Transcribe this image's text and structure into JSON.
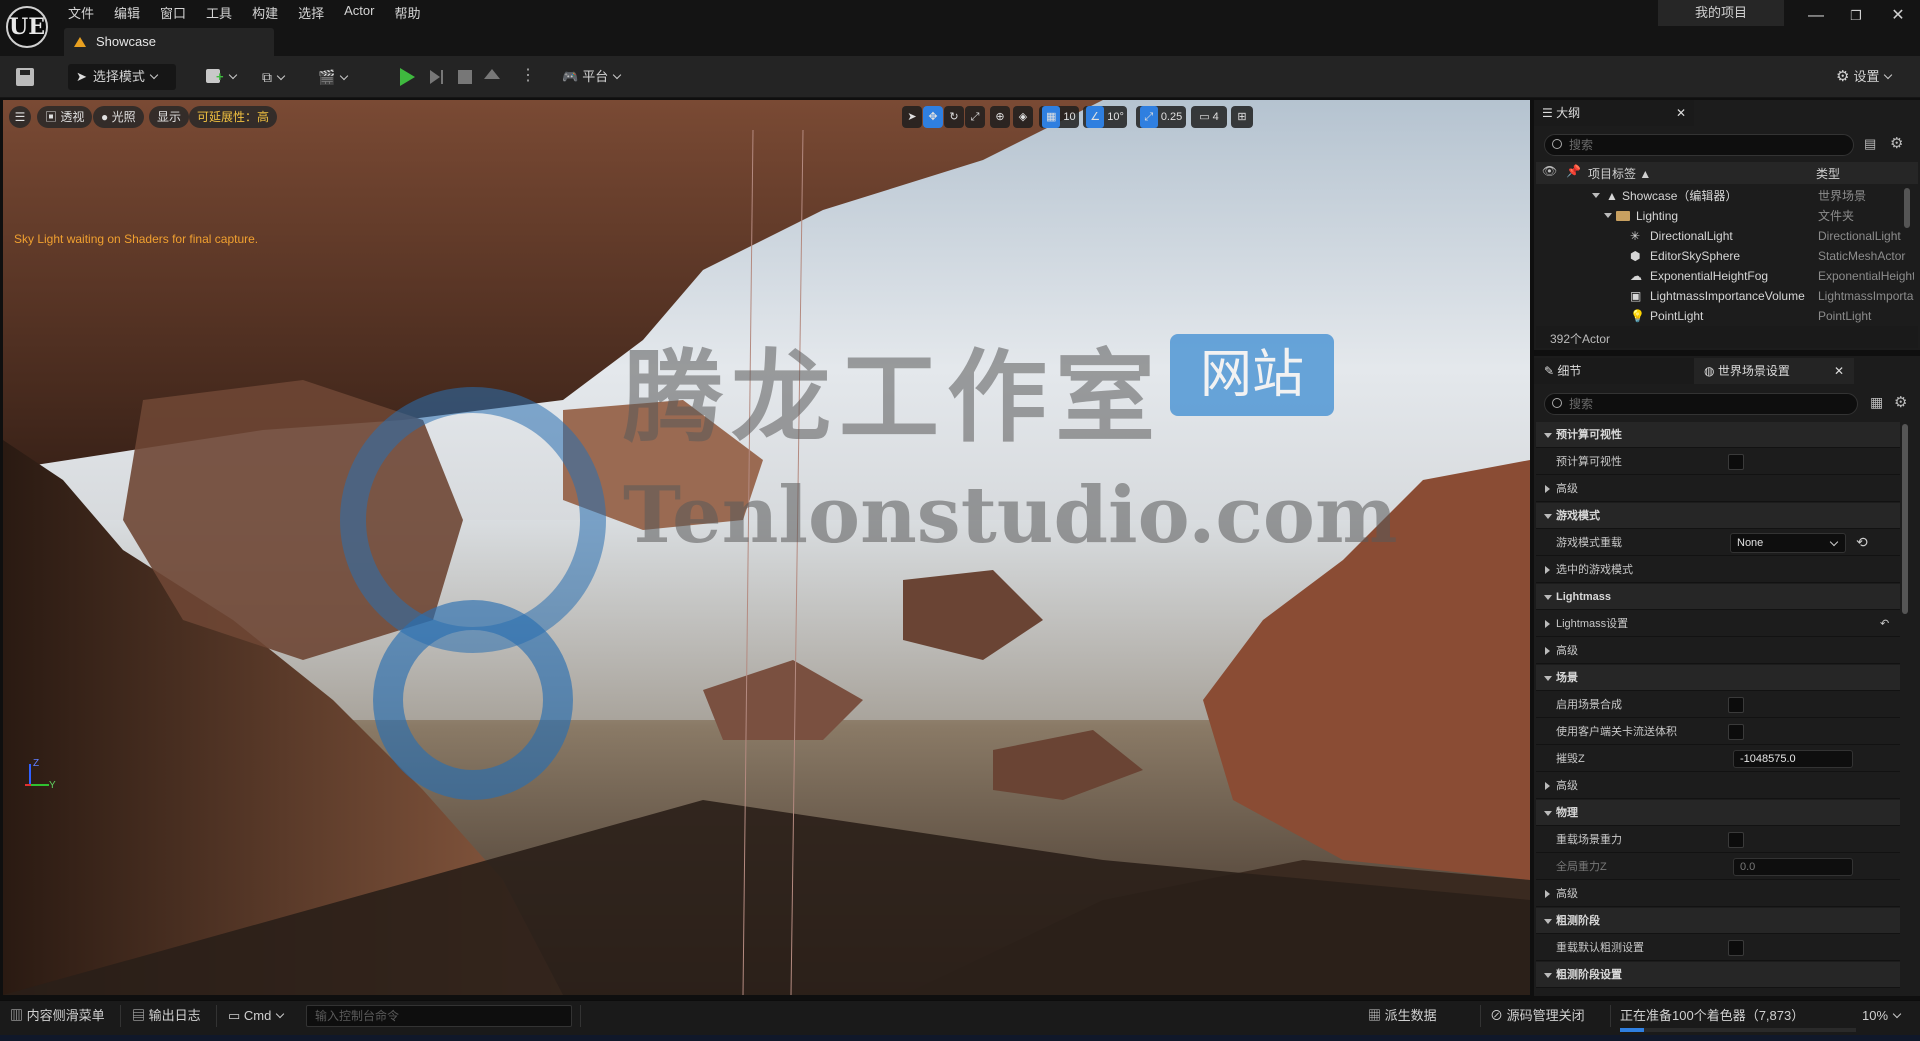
{
  "app": {
    "logo": "UE"
  },
  "menu": [
    "文件",
    "编辑",
    "窗口",
    "工具",
    "构建",
    "选择",
    "Actor",
    "帮助"
  ],
  "document_tab": {
    "label": "Showcase"
  },
  "project_name": "我的项目",
  "window_controls": {
    "minimize": "—",
    "restore": "❐",
    "close": "✕"
  },
  "toolbar": {
    "mode_label": "选择模式",
    "platform_label": "平台",
    "settings_label": "设置"
  },
  "viewport": {
    "chips": [
      "透视",
      "光照",
      "显示"
    ],
    "scalability_label": "可延展性：高",
    "grid_snap": "10",
    "rotation_snap": "10°",
    "scale_snap": "0.25",
    "camera_speed": "4",
    "message": "Sky Light waiting on Shaders for final capture.",
    "watermark_cn": "腾龙工作室",
    "watermark_badge": "网站",
    "watermark_en": "Tenlonstudio.com",
    "axis_label_z": "Z",
    "axis_label_y": "Y"
  },
  "outliner": {
    "title": "大纲",
    "search_placeholder": "搜索",
    "col_label": "项目标签 ▲",
    "col_type": "类型",
    "rows": [
      {
        "label": "Showcase（编辑器）",
        "type": "世界场景"
      },
      {
        "label": "Lighting",
        "type": "文件夹"
      },
      {
        "label": "DirectionalLight",
        "type": "DirectionalLight"
      },
      {
        "label": "EditorSkySphere",
        "type": "StaticMeshActor"
      },
      {
        "label": "ExponentialHeightFog",
        "type": "ExponentialHeightFog"
      },
      {
        "label": "LightmassImportanceVolume",
        "type": "LightmassImportanceVolume"
      },
      {
        "label": "PointLight",
        "type": "PointLight"
      }
    ],
    "count": "392个Actor"
  },
  "details": {
    "tab_details": "细节",
    "tab_world": "世界场景设置",
    "search_placeholder": "搜索",
    "rows": [
      {
        "label": "预计算可视性",
        "kind": "cat"
      },
      {
        "label": "预计算可视性",
        "kind": "prop"
      },
      {
        "label": "高级",
        "kind": "sub"
      },
      {
        "label": "游戏模式",
        "kind": "cat"
      },
      {
        "label": "游戏模式重载",
        "kind": "prop"
      },
      {
        "label": "选中的游戏模式",
        "kind": "sub"
      },
      {
        "label": "Lightmass",
        "kind": "cat"
      },
      {
        "label": "Lightmass设置",
        "kind": "sub"
      },
      {
        "label": "高级",
        "kind": "sub"
      },
      {
        "label": "场景",
        "kind": "cat"
      },
      {
        "label": "启用场景合成",
        "kind": "prop"
      },
      {
        "label": "使用客户端关卡流送体积",
        "kind": "prop"
      },
      {
        "label": "摧毁Z",
        "kind": "prop"
      },
      {
        "label": "高级",
        "kind": "sub"
      },
      {
        "label": "物理",
        "kind": "cat"
      },
      {
        "label": "重载场景重力",
        "kind": "prop"
      },
      {
        "label": "全局重力Z",
        "kind": "prop"
      },
      {
        "label": "高级",
        "kind": "sub"
      },
      {
        "label": "粗测阶段",
        "kind": "cat"
      },
      {
        "label": "重载默认粗测设置",
        "kind": "prop"
      },
      {
        "label": "粗测阶段设置",
        "kind": "cat"
      }
    ],
    "game_mode_value": "None",
    "kill_z_value": "-1048575.0",
    "gravity_z_value": "0.0"
  },
  "statusbar": {
    "content_drawer": "内容侧滑菜单",
    "output_log": "输出日志",
    "cmd": "Cmd",
    "console_placeholder": "输入控制台命令",
    "derived_data": "派生数据",
    "source_control": "源码管理关闭",
    "progress_text": "正在准备100个着色器（7,873）",
    "progress_percent": "10%",
    "progress_fraction": 0.1
  },
  "colors": {
    "accent_blue": "#2f7fe0",
    "play_green": "#3fb93f",
    "warning_orange": "#f0a030"
  }
}
